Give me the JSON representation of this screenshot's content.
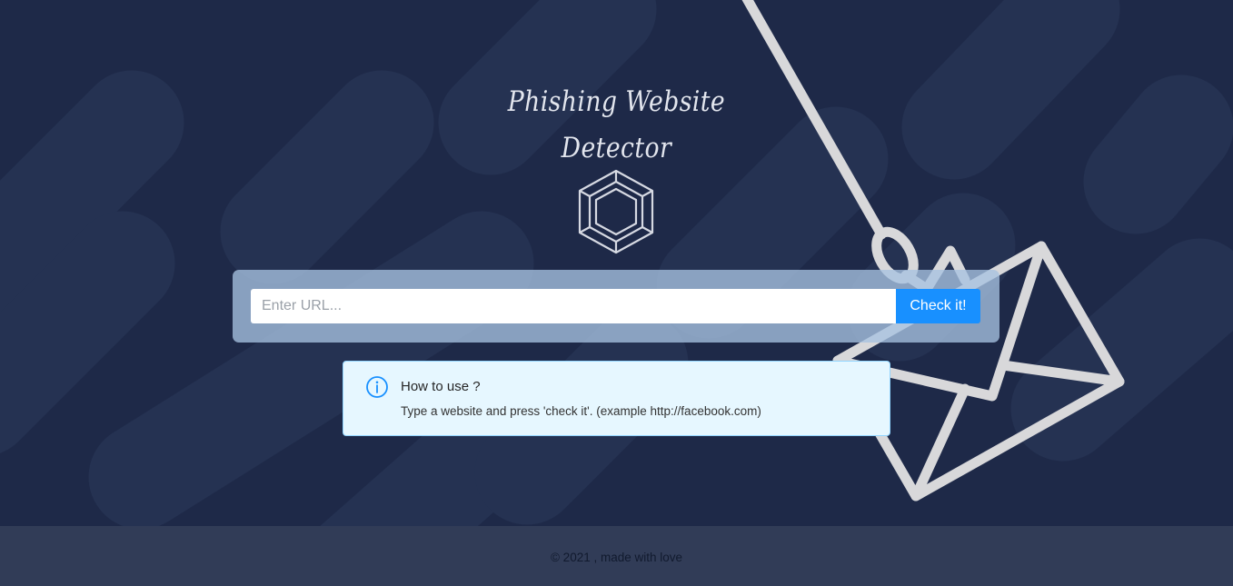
{
  "header": {
    "title_line1": "Phishing Website",
    "title_line2": "Detector",
    "logo_icon": "hexagon-logo-icon"
  },
  "search": {
    "placeholder": "Enter URL...",
    "value": "",
    "button_label": "Check it!"
  },
  "info": {
    "icon": "info-circle-icon",
    "title": "How to use ?",
    "description": "Type a website and press 'check it'. (example http://facebook.com)"
  },
  "footer": {
    "text": "© 2021 , made with love"
  },
  "decor": {
    "illustration": "fishing-hook-envelope-icon"
  },
  "colors": {
    "background": "#1e2948",
    "accent": "#1890ff",
    "info_bg": "#e6f7ff",
    "info_border": "#91d5ff",
    "footer_bg": "#313c57"
  }
}
